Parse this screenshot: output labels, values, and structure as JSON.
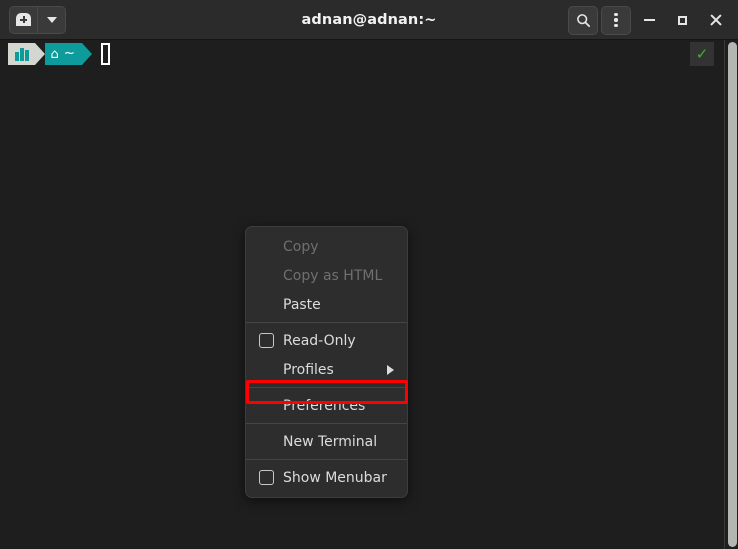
{
  "window": {
    "title": "adnan@adnan:~",
    "titlebar": {
      "new_tab_label": "new-tab",
      "dropdown_label": "tab-list",
      "search_label": "search",
      "menu_label": "menu",
      "minimize_label": "minimize",
      "maximize_label": "maximize",
      "close_label": "close"
    }
  },
  "terminal": {
    "prompt": {
      "segment_icon": "columns-icon",
      "home_icon": "⌂",
      "path": "~",
      "cursor": ""
    },
    "status_check": "✓",
    "colors": {
      "background": "#1e1e1e",
      "prompt_teal": "#0d9b9b",
      "prompt_gray": "#d3d7d0",
      "check_green": "#3fb22a"
    }
  },
  "context_menu": {
    "items": [
      {
        "label": "Copy",
        "type": "item",
        "disabled": true,
        "checkbox": false,
        "submenu": false
      },
      {
        "label": "Copy as HTML",
        "type": "item",
        "disabled": true,
        "checkbox": false,
        "submenu": false
      },
      {
        "label": "Paste",
        "type": "item",
        "disabled": false,
        "checkbox": false,
        "submenu": false
      },
      {
        "label": "Read-Only",
        "type": "item",
        "disabled": false,
        "checkbox": true,
        "checked": false,
        "submenu": false
      },
      {
        "label": "Profiles",
        "type": "item",
        "disabled": false,
        "checkbox": false,
        "submenu": true
      },
      {
        "label": "Preferences",
        "type": "item",
        "disabled": false,
        "checkbox": false,
        "submenu": false,
        "highlighted": true
      },
      {
        "label": "New Terminal",
        "type": "item",
        "disabled": false,
        "checkbox": false,
        "submenu": false
      },
      {
        "label": "Show Menubar",
        "type": "item",
        "disabled": false,
        "checkbox": true,
        "checked": false,
        "submenu": false
      }
    ],
    "highlight_color": "#ff0000"
  }
}
